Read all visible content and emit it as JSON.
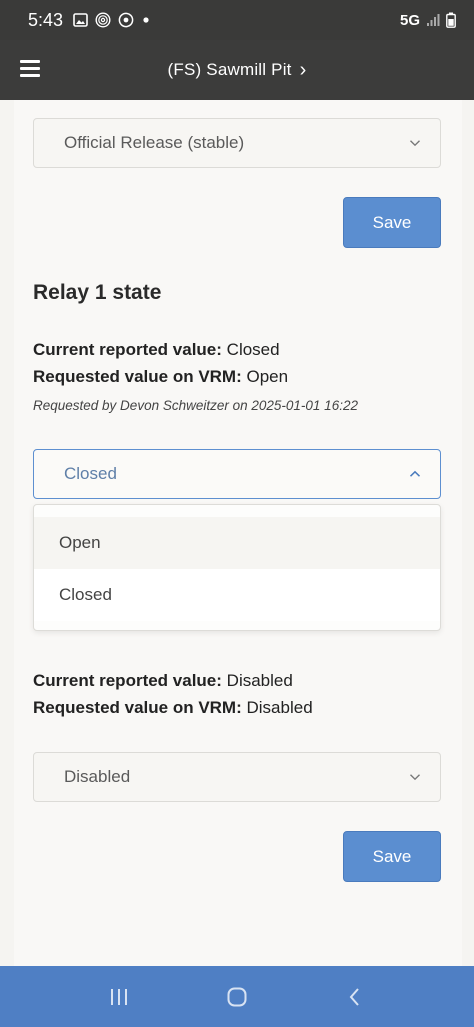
{
  "status_bar": {
    "time": "5:43",
    "network": "5G",
    "icons": [
      "gallery-icon",
      "fingerprint-icon",
      "location-icon",
      "dot-icon",
      "signal-icon",
      "battery-icon"
    ]
  },
  "app_bar": {
    "title": "(FS) Sawmill Pit",
    "chevron": "›"
  },
  "firmware": {
    "selected": "Official Release (stable)",
    "save_label": "Save"
  },
  "relay1": {
    "heading": "Relay 1 state",
    "current_label": "Current reported value:",
    "current_value": "Closed",
    "requested_label": "Requested value on VRM:",
    "requested_value": "Open",
    "note": "Requested by Devon Schweitzer on 2025-01-01 16:22",
    "selected": "Closed",
    "options": [
      "Open",
      "Closed"
    ]
  },
  "relay2": {
    "current_label": "Current reported value:",
    "current_value": "Disabled",
    "requested_label": "Requested value on VRM:",
    "requested_value": "Disabled",
    "selected": "Disabled",
    "save_label": "Save"
  },
  "colors": {
    "accent": "#5b8ed0",
    "nav_bar": "#4f7fc4",
    "app_bar": "#3c3c3b"
  }
}
